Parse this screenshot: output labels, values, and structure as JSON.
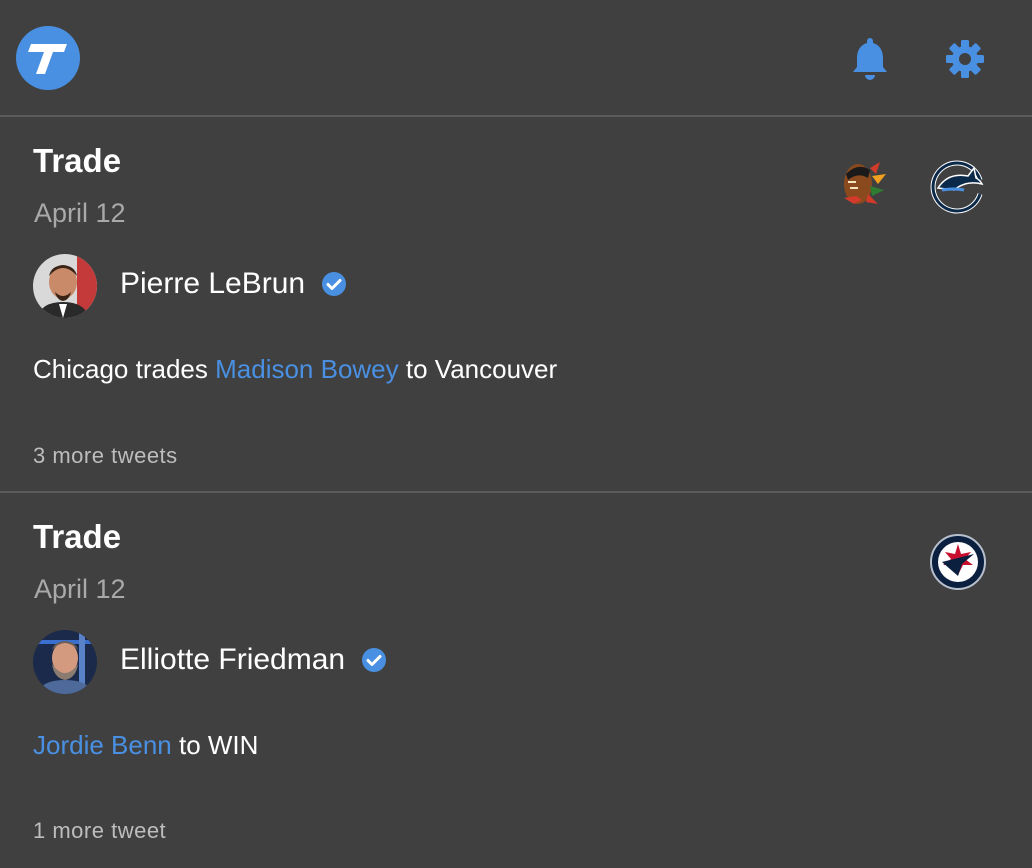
{
  "header": {
    "logo_icon": "t-logo-icon",
    "notifications_icon": "bell-icon",
    "settings_icon": "gear-icon",
    "accent": "#4a90e2"
  },
  "cards": [
    {
      "type": "Trade",
      "date": "April 12",
      "author": "Pierre LeBrun",
      "verified": true,
      "text_before": "Chicago trades ",
      "link_text": "Madison Bowey",
      "text_after": " to Vancouver",
      "more": "3 more tweets",
      "teams": [
        "blackhawks-logo",
        "canucks-logo"
      ]
    },
    {
      "type": "Trade",
      "date": "April 12",
      "author": "Elliotte Friedman",
      "verified": true,
      "text_before": "",
      "link_text": "Jordie Benn",
      "text_after": " to WIN",
      "more": "1 more tweet",
      "teams": [
        "jets-logo"
      ]
    }
  ]
}
